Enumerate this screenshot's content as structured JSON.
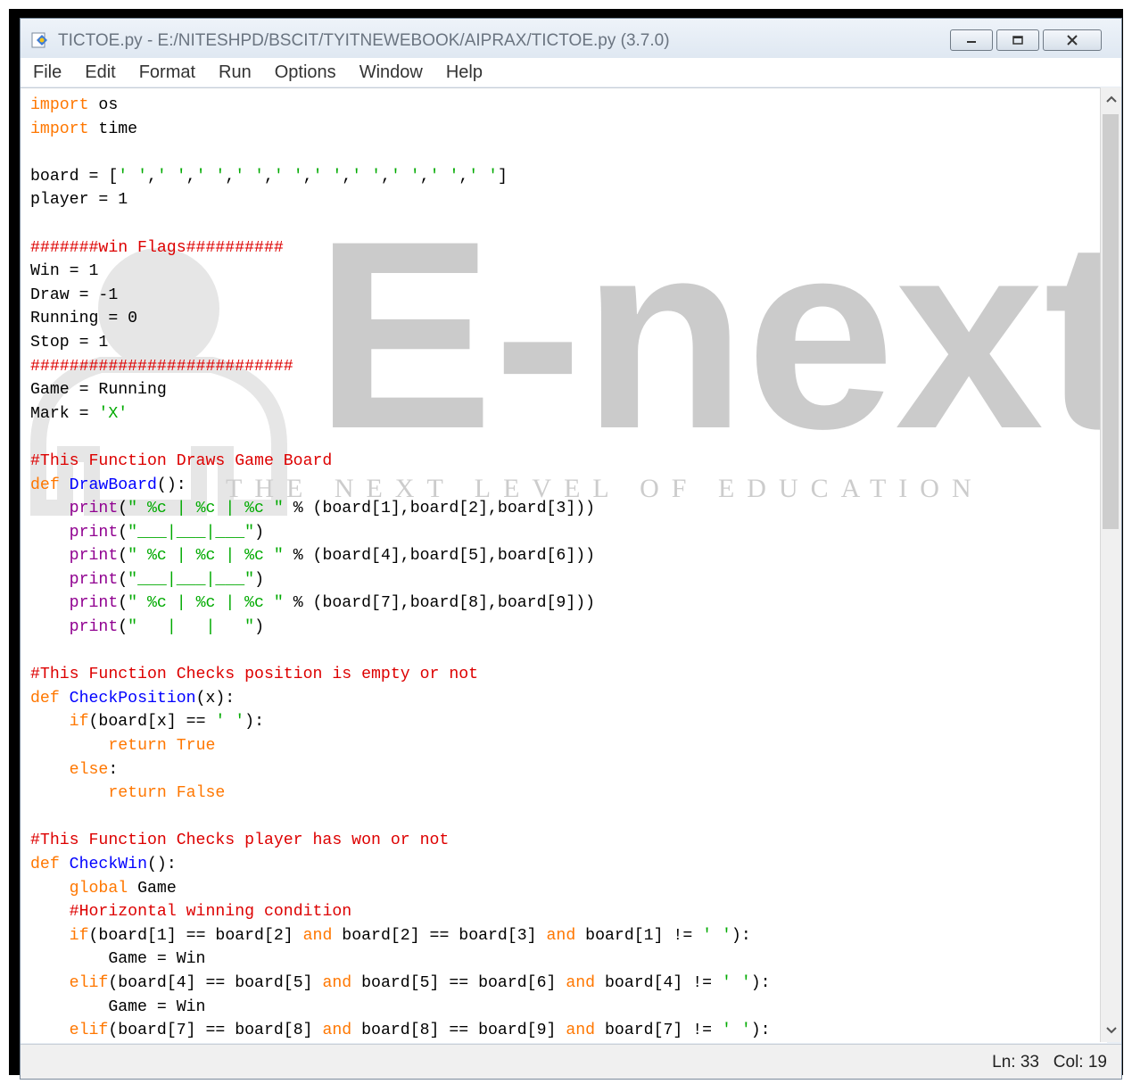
{
  "window": {
    "title": "TICTOE.py - E:/NITESHPD/BSCIT/TYITNEWEBOOK/AIPRAX/TICTOE.py (3.7.0)"
  },
  "menu": [
    "File",
    "Edit",
    "Format",
    "Run",
    "Options",
    "Window",
    "Help"
  ],
  "watermark": {
    "logo_text": "E-next",
    "tagline": "THE NEXT LEVEL OF EDUCATION"
  },
  "code_lines": [
    [
      {
        "t": "import",
        "c": "kw"
      },
      {
        "t": " os"
      }
    ],
    [
      {
        "t": "import",
        "c": "kw"
      },
      {
        "t": " time"
      }
    ],
    [],
    [
      {
        "t": "board = ["
      },
      {
        "t": "' '",
        "c": "str"
      },
      {
        "t": ","
      },
      {
        "t": "' '",
        "c": "str"
      },
      {
        "t": ","
      },
      {
        "t": "' '",
        "c": "str"
      },
      {
        "t": ","
      },
      {
        "t": "' '",
        "c": "str"
      },
      {
        "t": ","
      },
      {
        "t": "' '",
        "c": "str"
      },
      {
        "t": ","
      },
      {
        "t": "' '",
        "c": "str"
      },
      {
        "t": ","
      },
      {
        "t": "' '",
        "c": "str"
      },
      {
        "t": ","
      },
      {
        "t": "' '",
        "c": "str"
      },
      {
        "t": ","
      },
      {
        "t": "' '",
        "c": "str"
      },
      {
        "t": ","
      },
      {
        "t": "' '",
        "c": "str"
      },
      {
        "t": "]"
      }
    ],
    [
      {
        "t": "player = 1"
      }
    ],
    [],
    [
      {
        "t": "#######win Flags##########",
        "c": "cm"
      }
    ],
    [
      {
        "t": "Win = 1"
      }
    ],
    [
      {
        "t": "Draw = -1"
      }
    ],
    [
      {
        "t": "Running = 0"
      }
    ],
    [
      {
        "t": "Stop = 1"
      }
    ],
    [
      {
        "t": "###########################",
        "c": "cm"
      }
    ],
    [
      {
        "t": "Game = Running"
      }
    ],
    [
      {
        "t": "Mark = "
      },
      {
        "t": "'X'",
        "c": "str"
      }
    ],
    [],
    [
      {
        "t": "#This Function Draws Game Board",
        "c": "cm"
      }
    ],
    [
      {
        "t": "def",
        "c": "kw"
      },
      {
        "t": " "
      },
      {
        "t": "DrawBoard",
        "c": "fn"
      },
      {
        "t": "():"
      }
    ],
    [
      {
        "t": "    "
      },
      {
        "t": "print",
        "c": "bi"
      },
      {
        "t": "("
      },
      {
        "t": "\" %c | %c | %c \"",
        "c": "str"
      },
      {
        "t": " % (board[1],board[2],board[3]))"
      }
    ],
    [
      {
        "t": "    "
      },
      {
        "t": "print",
        "c": "bi"
      },
      {
        "t": "("
      },
      {
        "t": "\"___|___|___\"",
        "c": "str"
      },
      {
        "t": ")"
      }
    ],
    [
      {
        "t": "    "
      },
      {
        "t": "print",
        "c": "bi"
      },
      {
        "t": "("
      },
      {
        "t": "\" %c | %c | %c \"",
        "c": "str"
      },
      {
        "t": " % (board[4],board[5],board[6]))"
      }
    ],
    [
      {
        "t": "    "
      },
      {
        "t": "print",
        "c": "bi"
      },
      {
        "t": "("
      },
      {
        "t": "\"___|___|___\"",
        "c": "str"
      },
      {
        "t": ")"
      }
    ],
    [
      {
        "t": "    "
      },
      {
        "t": "print",
        "c": "bi"
      },
      {
        "t": "("
      },
      {
        "t": "\" %c | %c | %c \"",
        "c": "str"
      },
      {
        "t": " % (board[7],board[8],board[9]))"
      }
    ],
    [
      {
        "t": "    "
      },
      {
        "t": "print",
        "c": "bi"
      },
      {
        "t": "("
      },
      {
        "t": "\"   |   |   \"",
        "c": "str"
      },
      {
        "t": ")"
      }
    ],
    [],
    [
      {
        "t": "#This Function Checks position is empty or not",
        "c": "cm"
      }
    ],
    [
      {
        "t": "def",
        "c": "kw"
      },
      {
        "t": " "
      },
      {
        "t": "CheckPosition",
        "c": "fn"
      },
      {
        "t": "(x):"
      }
    ],
    [
      {
        "t": "    "
      },
      {
        "t": "if",
        "c": "kw"
      },
      {
        "t": "(board[x] == "
      },
      {
        "t": "' '",
        "c": "str"
      },
      {
        "t": "):"
      }
    ],
    [
      {
        "t": "        "
      },
      {
        "t": "return",
        "c": "kw"
      },
      {
        "t": " "
      },
      {
        "t": "True",
        "c": "kw"
      }
    ],
    [
      {
        "t": "    "
      },
      {
        "t": "else",
        "c": "kw"
      },
      {
        "t": ":"
      }
    ],
    [
      {
        "t": "        "
      },
      {
        "t": "return",
        "c": "kw"
      },
      {
        "t": " "
      },
      {
        "t": "False",
        "c": "kw"
      }
    ],
    [],
    [
      {
        "t": "#This Function Checks player has won or not",
        "c": "cm"
      }
    ],
    [
      {
        "t": "def",
        "c": "kw"
      },
      {
        "t": " "
      },
      {
        "t": "CheckWin",
        "c": "fn"
      },
      {
        "t": "():"
      }
    ],
    [
      {
        "t": "    "
      },
      {
        "t": "global",
        "c": "kw"
      },
      {
        "t": " Game"
      }
    ],
    [
      {
        "t": "    "
      },
      {
        "t": "#Horizontal winning condition",
        "c": "cm"
      }
    ],
    [
      {
        "t": "    "
      },
      {
        "t": "if",
        "c": "kw"
      },
      {
        "t": "(board[1] == board[2] "
      },
      {
        "t": "and",
        "c": "kw"
      },
      {
        "t": " board[2] == board[3] "
      },
      {
        "t": "and",
        "c": "kw"
      },
      {
        "t": " board[1] != "
      },
      {
        "t": "' '",
        "c": "str"
      },
      {
        "t": "):"
      }
    ],
    [
      {
        "t": "        Game = Win"
      }
    ],
    [
      {
        "t": "    "
      },
      {
        "t": "elif",
        "c": "kw"
      },
      {
        "t": "(board[4] == board[5] "
      },
      {
        "t": "and",
        "c": "kw"
      },
      {
        "t": " board[5] == board[6] "
      },
      {
        "t": "and",
        "c": "kw"
      },
      {
        "t": " board[4] != "
      },
      {
        "t": "' '",
        "c": "str"
      },
      {
        "t": "):"
      }
    ],
    [
      {
        "t": "        Game = Win"
      }
    ],
    [
      {
        "t": "    "
      },
      {
        "t": "elif",
        "c": "kw"
      },
      {
        "t": "(board[7] == board[8] "
      },
      {
        "t": "and",
        "c": "kw"
      },
      {
        "t": " board[8] == board[9] "
      },
      {
        "t": "and",
        "c": "kw"
      },
      {
        "t": " board[7] != "
      },
      {
        "t": "' '",
        "c": "str"
      },
      {
        "t": "):"
      }
    ]
  ],
  "status": {
    "ln": "Ln: 33",
    "col": "Col: 19"
  },
  "colors": {
    "keyword": "#ff7700",
    "string": "#00aa00",
    "comment": "#dd0000",
    "definition": "#0000ff",
    "builtin": "#900090"
  }
}
